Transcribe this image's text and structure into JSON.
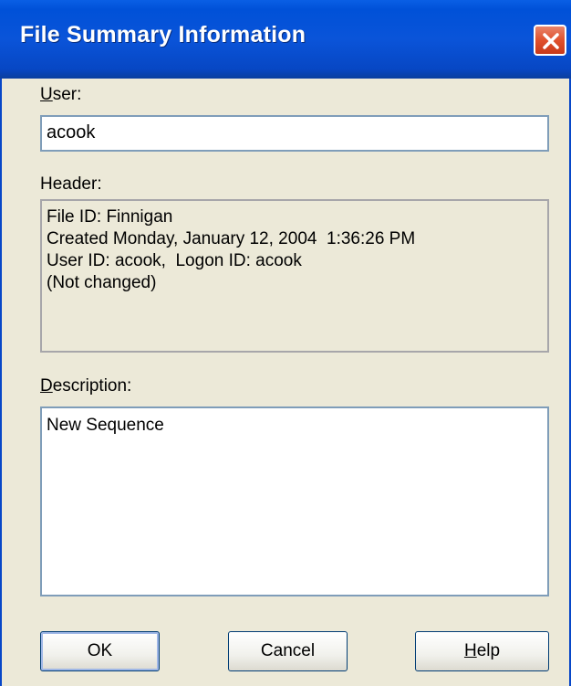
{
  "window": {
    "title": "File Summary Information"
  },
  "user": {
    "label_accel": "U",
    "label_rest": "ser:",
    "value": "acook"
  },
  "header": {
    "label": "Header:",
    "lines": [
      "File ID: Finnigan",
      "Created Monday, January 12, 2004  1:36:26 PM",
      "User ID: acook,  Logon ID: acook",
      "(Not changed)"
    ]
  },
  "description": {
    "label_accel": "D",
    "label_rest": "escription:",
    "value": "New Sequence"
  },
  "buttons": {
    "ok": "OK",
    "cancel": "Cancel",
    "help_accel": "H",
    "help_rest": "elp"
  },
  "colors": {
    "titlebar": "#0a54d9",
    "close": "#e0512d",
    "dialog_bg": "#ece9d8"
  }
}
